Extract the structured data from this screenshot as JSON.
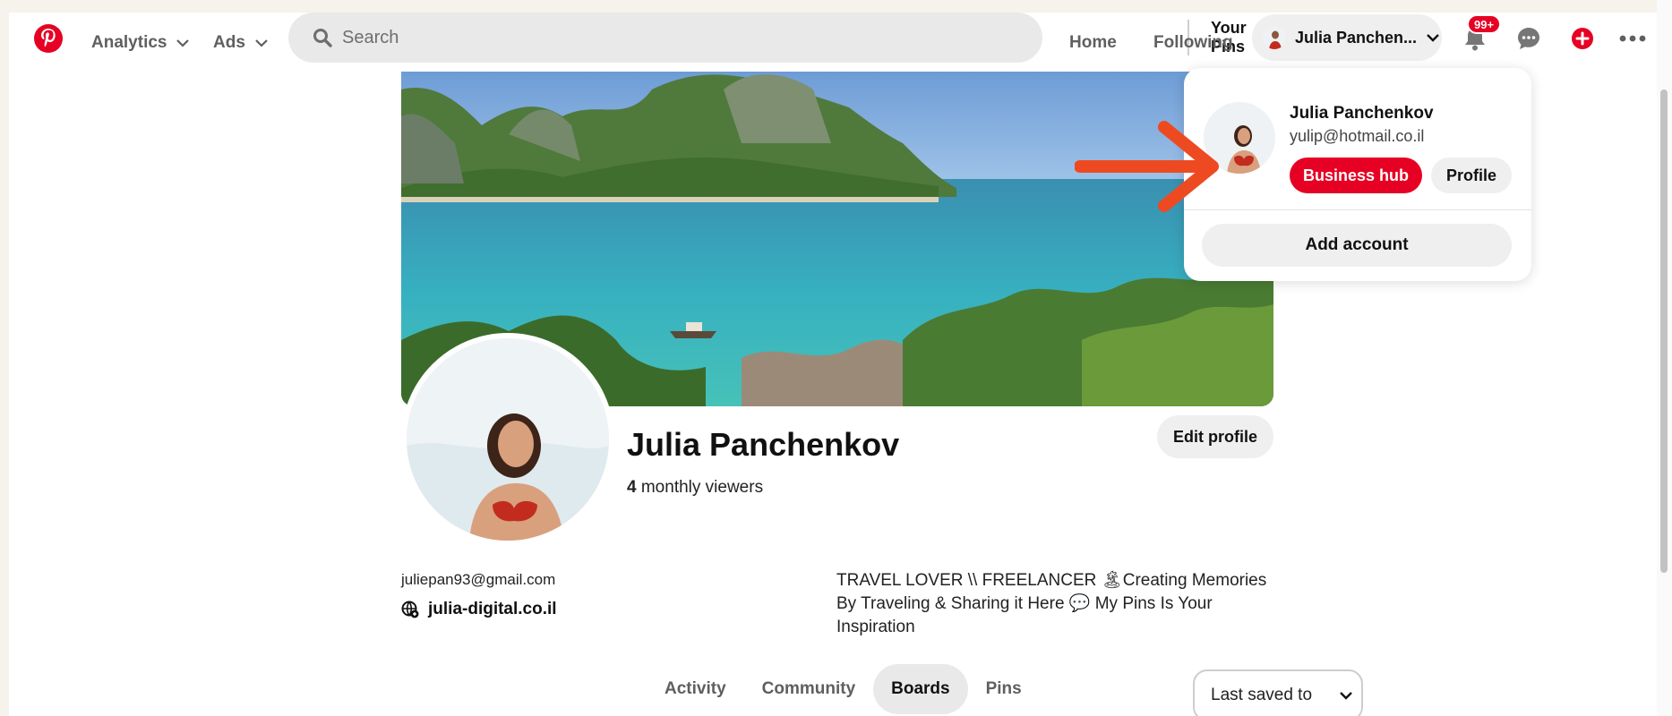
{
  "header": {
    "nav": {
      "analytics_label": "Analytics",
      "ads_label": "Ads",
      "home_label": "Home",
      "following_label": "Following"
    },
    "search": {
      "placeholder": "Search"
    },
    "your_pins_label": "Your Pins",
    "account_name": "Julia Panchen...",
    "notifications_badge": "99+",
    "colors": {
      "brand": "#e60023"
    },
    "icons": [
      "pinterest-logo-icon",
      "chevron-down-icon",
      "search-icon",
      "bell-icon",
      "chat-icon",
      "plus-icon",
      "more-icon"
    ]
  },
  "profile": {
    "name": "Julia Panchenkov",
    "viewers_count": "4",
    "viewers_label": "monthly viewers",
    "edit_label": "Edit profile",
    "email": "juliepan93@gmail.com",
    "website": "julia-digital.co.il",
    "bio": "TRAVEL LOVER \\\\ FREELANCER 🏝Creating Memories By Traveling & Sharing it Here 💬 My Pins Is Your Inspiration"
  },
  "tabs": [
    {
      "label": "Activity",
      "active": false
    },
    {
      "label": "Community",
      "active": false
    },
    {
      "label": "Boards",
      "active": true
    },
    {
      "label": "Pins",
      "active": false
    }
  ],
  "sort": {
    "selected": "Last saved to"
  },
  "account_menu": {
    "name": "Julia Panchenkov",
    "email": "yulip@hotmail.co.il",
    "business_hub_label": "Business hub",
    "profile_label": "Profile",
    "add_account_label": "Add account",
    "arrow_color": "#ee4a22"
  }
}
